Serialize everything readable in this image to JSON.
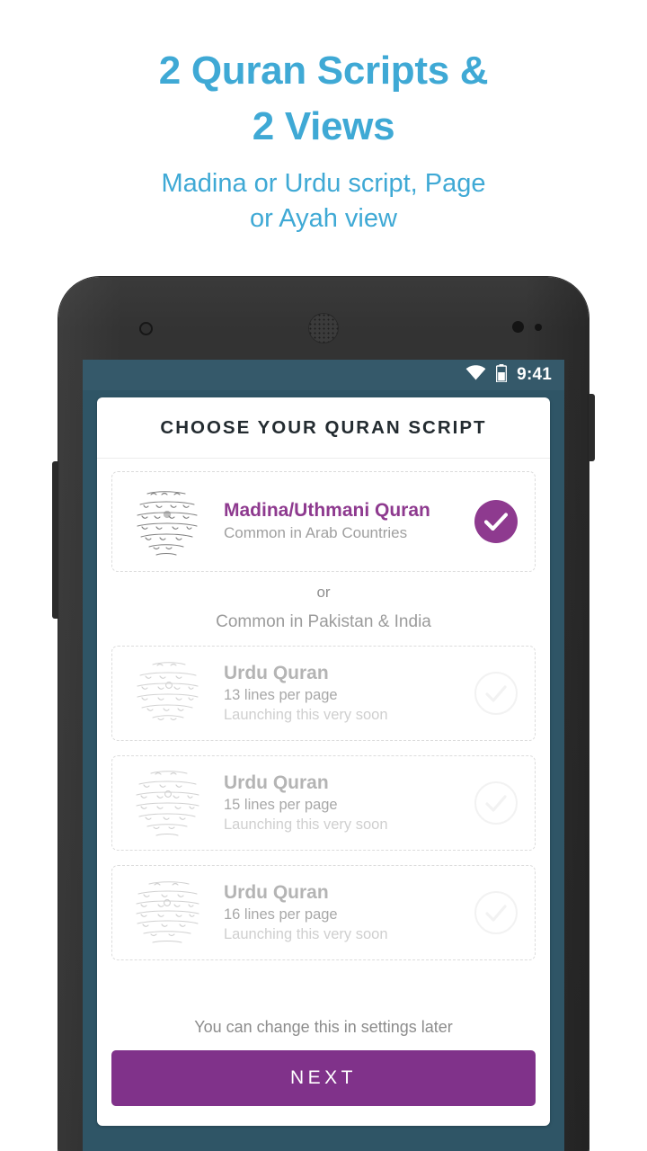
{
  "promo": {
    "title_line1": "2 Quran Scripts &",
    "title_line2": "2 Views",
    "subtitle_line1": "Madina or Urdu script, Page",
    "subtitle_line2": "or Ayah view",
    "accent_color": "#3FA9D5"
  },
  "device": {
    "body_color": "#303030",
    "screen_background": "#2f5566"
  },
  "statusbar": {
    "time": "9:41",
    "wifi_icon": "wifi-icon",
    "battery_icon": "battery-icon",
    "background": "#35596a"
  },
  "app": {
    "header_title": "CHOOSE YOUR QURAN SCRIPT",
    "options": [
      {
        "title": "Madina/Uthmani Quran",
        "subtitle": "Common in Arab Countries",
        "note": "",
        "selected": true,
        "state": "enabled",
        "thumbnail": "arabic-script-thumbnail",
        "check_icon": "check-circle-filled-icon",
        "accent_color": "#8e3a8f"
      },
      {
        "title": "Urdu Quran",
        "subtitle": "13 lines per page",
        "note": "Launching this very soon",
        "selected": false,
        "state": "disabled",
        "thumbnail": "urdu-script-thumbnail",
        "check_icon": "check-circle-outline-icon",
        "accent_color": "#f2f2f2"
      },
      {
        "title": "Urdu Quran",
        "subtitle": "15 lines per page",
        "note": "Launching this very soon",
        "selected": false,
        "state": "disabled",
        "thumbnail": "urdu-script-thumbnail",
        "check_icon": "check-circle-outline-icon",
        "accent_color": "#f2f2f2"
      },
      {
        "title": "Urdu Quran",
        "subtitle": "16 lines per page",
        "note": "Launching this very soon",
        "selected": false,
        "state": "disabled",
        "thumbnail": "urdu-script-thumbnail",
        "check_icon": "check-circle-outline-icon",
        "accent_color": "#f2f2f2"
      }
    ],
    "divider_word": "or",
    "divider_note": "Common in Pakistan & India",
    "footer_note": "You can change this in settings later",
    "next_label": "NEXT",
    "next_button_color": "#80328a"
  }
}
